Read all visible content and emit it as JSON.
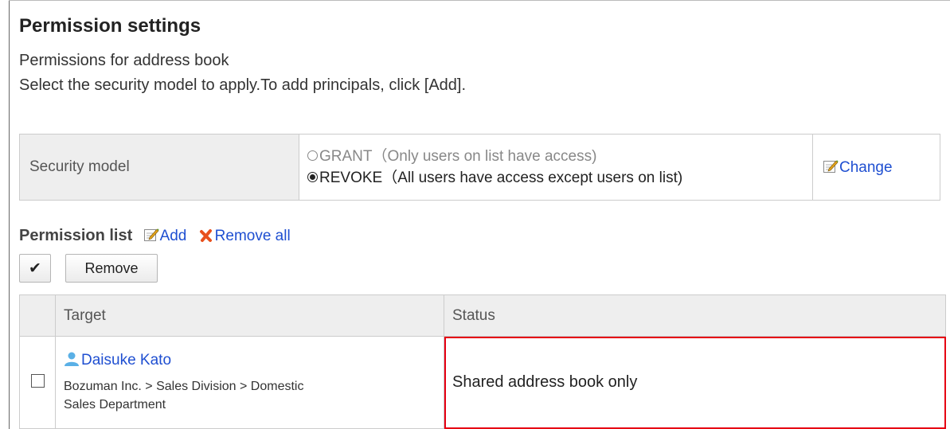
{
  "page": {
    "title": "Permission settings",
    "description1": "Permissions for address book",
    "description2": "Select the security model to apply.To add principals, click [Add]."
  },
  "security_model": {
    "label": "Security model",
    "options": [
      {
        "label": "GRANT（Only users on list have access)",
        "selected": false
      },
      {
        "label": "REVOKE（All users have access except users on list)",
        "selected": true
      }
    ],
    "change_label": "Change",
    "change_icon": "edit-icon"
  },
  "permission_list": {
    "title": "Permission list",
    "add_label": "Add",
    "remove_all_label": "Remove all",
    "check_button_label": "✔",
    "remove_button_label": "Remove",
    "columns": {
      "target": "Target",
      "status": "Status"
    },
    "rows": [
      {
        "name": "Daisuke Kato",
        "org_line1": "Bozuman Inc. > Sales Division > Domestic",
        "org_line2": "Sales Department",
        "status": "Shared address book only",
        "checked": false
      }
    ]
  },
  "colors": {
    "link": "#1f4fd1",
    "highlight": "#e60012",
    "header_bg": "#eeeeee"
  }
}
